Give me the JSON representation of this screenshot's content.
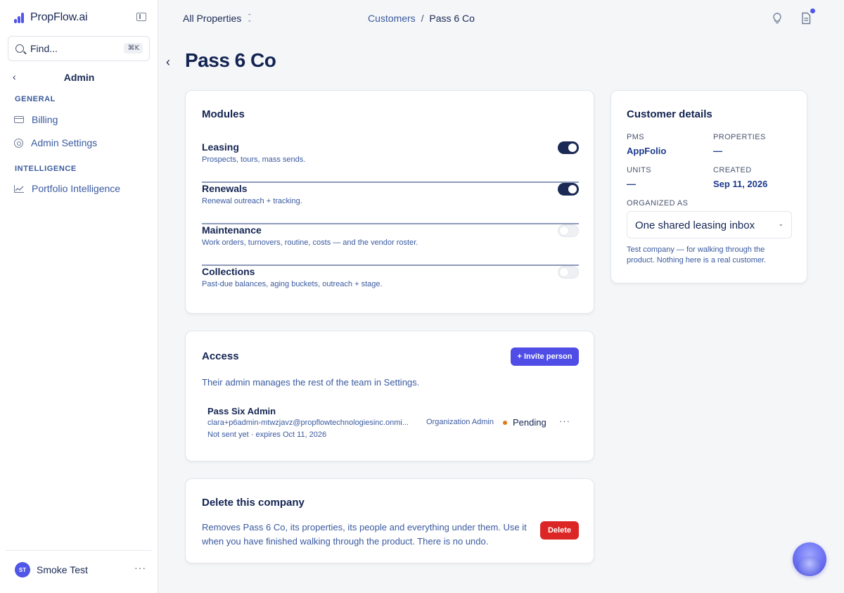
{
  "app": {
    "name": "PropFlow.ai"
  },
  "sidebar": {
    "search": {
      "placeholder": "Find...",
      "shortcut": "⌘K"
    },
    "section_title": "Admin",
    "groups": [
      {
        "label": "GENERAL",
        "items": [
          {
            "label": "Billing",
            "icon": "credit-card-icon"
          },
          {
            "label": "Admin Settings",
            "icon": "gear-icon"
          }
        ]
      },
      {
        "label": "INTELLIGENCE",
        "items": [
          {
            "label": "Portfolio Intelligence",
            "icon": "line-chart-icon"
          }
        ]
      }
    ],
    "user": {
      "initials": "ST",
      "name": "Smoke Test"
    }
  },
  "topbar": {
    "property_select": "All Properties",
    "breadcrumb": {
      "parent": "Customers",
      "separator": "/",
      "current": "Pass 6 Co"
    }
  },
  "page": {
    "title": "Pass 6 Co"
  },
  "modules": {
    "title": "Modules",
    "items": [
      {
        "name": "Leasing",
        "description": "Prospects, tours, mass sends.",
        "enabled": true
      },
      {
        "name": "Renewals",
        "description": "Renewal outreach + tracking.",
        "enabled": true
      },
      {
        "name": "Maintenance",
        "description": "Work orders, turnovers, routine, costs — and the vendor roster.",
        "enabled": false
      },
      {
        "name": "Collections",
        "description": "Past-due balances, aging buckets, outreach + stage.",
        "enabled": false
      }
    ]
  },
  "access": {
    "title": "Access",
    "invite_label": "+ Invite person",
    "subtitle": "Their admin manages the rest of the team in Settings.",
    "person": {
      "name": "Pass Six Admin",
      "email": "clara+p6admin-mtwzjavz@propflowtechnologiesinc.onmi...",
      "expiry": "Not sent yet · expires Oct 11, 2026",
      "role": "Organization Admin",
      "status": "Pending",
      "status_color": "#e07a14"
    }
  },
  "delete": {
    "title": "Delete this company",
    "text": "Removes Pass 6 Co, its properties, its people and everything under them. Use it when you have finished walking through the product. There is no undo.",
    "button_label": "Delete",
    "button_color": "#dc2626"
  },
  "customer_details": {
    "title": "Customer details",
    "pms_label": "PMS",
    "pms_value": "AppFolio",
    "properties_label": "PROPERTIES",
    "properties_value": "—",
    "units_label": "UNITS",
    "units_value": "—",
    "created_label": "CREATED",
    "created_value": "Sep 11, 2026",
    "organized_label": "ORGANIZED AS",
    "organized_value": "One shared leasing inbox",
    "note": "Test company — for walking through the product. Nothing here is a real customer."
  },
  "colors": {
    "accent": "#4f4de6",
    "navy": "#132452"
  }
}
